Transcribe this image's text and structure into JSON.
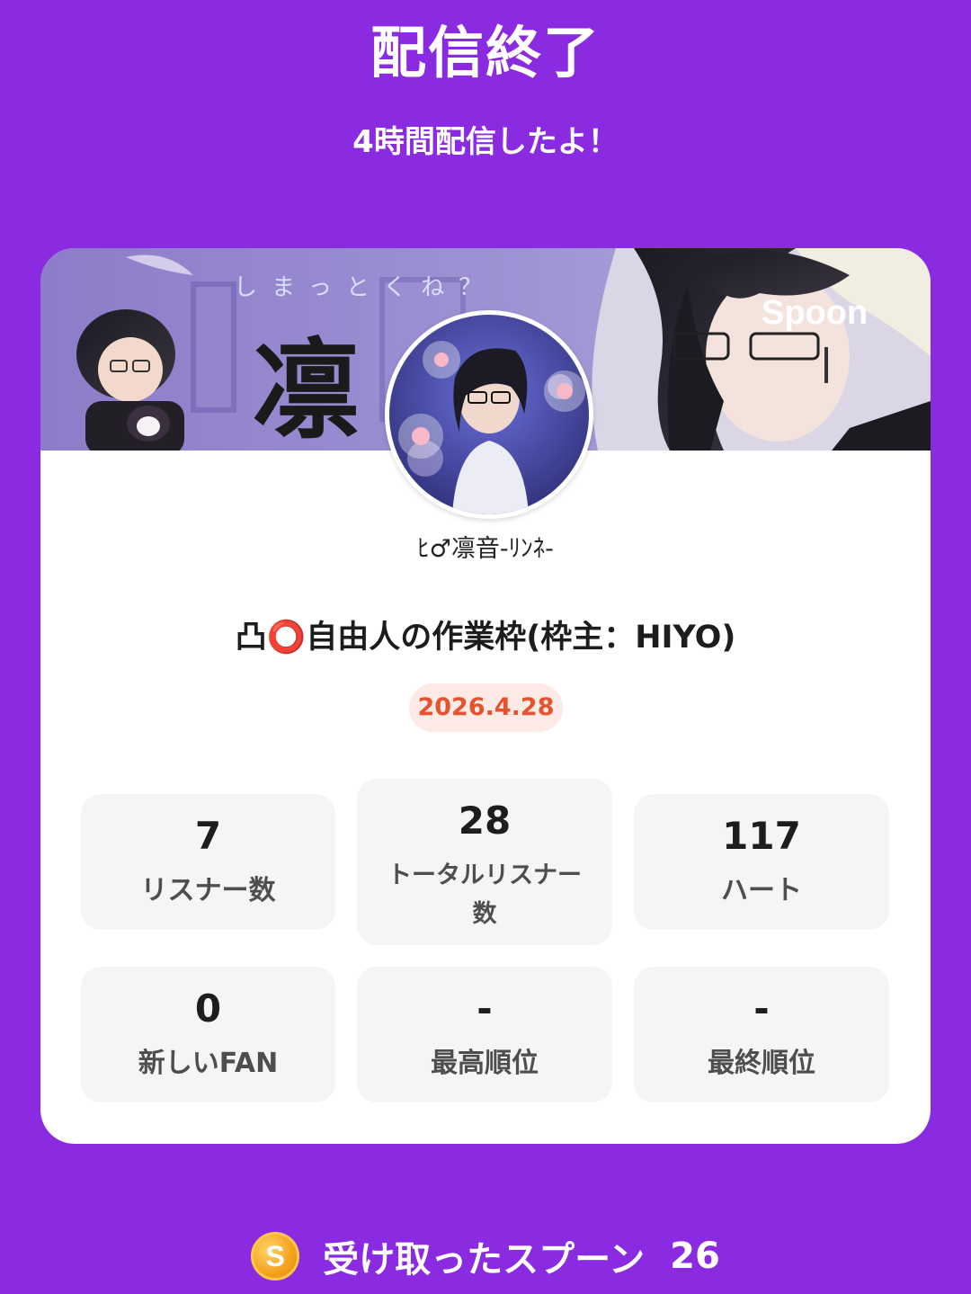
{
  "header": {
    "title": "配信終了",
    "subtitle": "4時間配信したよ！"
  },
  "banner": {
    "kanji": "凛",
    "tagline": "しまっとくね？",
    "brand": "Spoon"
  },
  "profile": {
    "username": "ﾋ♂凛音-ﾘﾝﾈ-"
  },
  "live": {
    "title": "凸⭕自由人の作業枠(枠主：HIYO)",
    "date": "2026.4.28"
  },
  "stats": [
    {
      "value": "7",
      "label": "リスナー数"
    },
    {
      "value": "28",
      "label": "トータルリスナー数"
    },
    {
      "value": "117",
      "label": "ハート"
    },
    {
      "value": "0",
      "label": "新しいFAN"
    },
    {
      "value": "-",
      "label": "最高順位"
    },
    {
      "value": "-",
      "label": "最終順位"
    }
  ],
  "spoons": {
    "icon_letter": "S",
    "label": "受け取ったスプーン",
    "count": "26"
  },
  "colors": {
    "background": "#8a2be2",
    "date_badge_bg": "#fdeae6",
    "date_badge_text": "#e4532d",
    "stat_box": "#f5f5f5",
    "coin": "#f4a21c"
  }
}
